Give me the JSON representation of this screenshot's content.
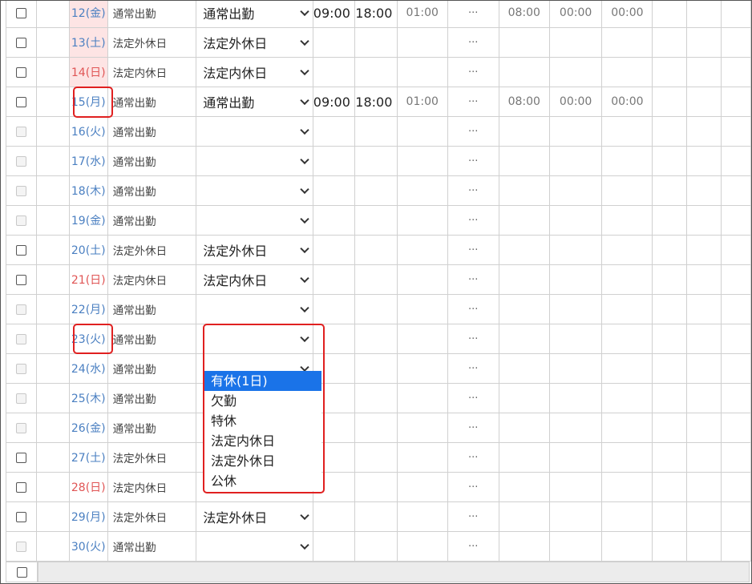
{
  "rows": [
    {
      "date": "12(金)",
      "color": "blue",
      "pink": true,
      "type": "通常出勤",
      "select": "通常出勤",
      "in": "09:00",
      "out": "18:00",
      "brk": "01:00",
      "dots": "···",
      "w1": "08:00",
      "w2": "00:00",
      "w3": "00:00",
      "disabled": false
    },
    {
      "date": "13(土)",
      "color": "blue",
      "pink": true,
      "type": "法定外休日",
      "select": "法定外休日",
      "in": "",
      "out": "",
      "brk": "",
      "dots": "···",
      "w1": "",
      "w2": "",
      "w3": "",
      "disabled": false
    },
    {
      "date": "14(日)",
      "color": "red",
      "pink": true,
      "type": "法定内休日",
      "select": "法定内休日",
      "in": "",
      "out": "",
      "brk": "",
      "dots": "···",
      "w1": "",
      "w2": "",
      "w3": "",
      "disabled": false
    },
    {
      "date": "15(月)",
      "color": "blue",
      "pink": false,
      "type": "通常出勤",
      "select": "通常出勤",
      "in": "09:00",
      "out": "18:00",
      "brk": "01:00",
      "dots": "···",
      "w1": "08:00",
      "w2": "00:00",
      "w3": "00:00",
      "disabled": false
    },
    {
      "date": "16(火)",
      "color": "blue",
      "pink": false,
      "type": "通常出勤",
      "select": "",
      "in": "",
      "out": "",
      "brk": "",
      "dots": "···",
      "w1": "",
      "w2": "",
      "w3": "",
      "disabled": true
    },
    {
      "date": "17(水)",
      "color": "blue",
      "pink": false,
      "type": "通常出勤",
      "select": "",
      "in": "",
      "out": "",
      "brk": "",
      "dots": "···",
      "w1": "",
      "w2": "",
      "w3": "",
      "disabled": true
    },
    {
      "date": "18(木)",
      "color": "blue",
      "pink": false,
      "type": "通常出勤",
      "select": "",
      "in": "",
      "out": "",
      "brk": "",
      "dots": "···",
      "w1": "",
      "w2": "",
      "w3": "",
      "disabled": true
    },
    {
      "date": "19(金)",
      "color": "blue",
      "pink": false,
      "type": "通常出勤",
      "select": "",
      "in": "",
      "out": "",
      "brk": "",
      "dots": "···",
      "w1": "",
      "w2": "",
      "w3": "",
      "disabled": true
    },
    {
      "date": "20(土)",
      "color": "blue",
      "pink": false,
      "type": "法定外休日",
      "select": "法定外休日",
      "in": "",
      "out": "",
      "brk": "",
      "dots": "···",
      "w1": "",
      "w2": "",
      "w3": "",
      "disabled": false
    },
    {
      "date": "21(日)",
      "color": "red",
      "pink": false,
      "type": "法定内休日",
      "select": "法定内休日",
      "in": "",
      "out": "",
      "brk": "",
      "dots": "···",
      "w1": "",
      "w2": "",
      "w3": "",
      "disabled": false
    },
    {
      "date": "22(月)",
      "color": "blue",
      "pink": false,
      "type": "通常出勤",
      "select": "",
      "in": "",
      "out": "",
      "brk": "",
      "dots": "···",
      "w1": "",
      "w2": "",
      "w3": "",
      "disabled": true
    },
    {
      "date": "23(火)",
      "color": "blue",
      "pink": false,
      "type": "通常出勤",
      "select": "",
      "in": "",
      "out": "",
      "brk": "",
      "dots": "···",
      "w1": "",
      "w2": "",
      "w3": "",
      "disabled": true
    },
    {
      "date": "24(水)",
      "color": "blue",
      "pink": false,
      "type": "通常出勤",
      "select": "",
      "in": "",
      "out": "",
      "brk": "",
      "dots": "···",
      "w1": "",
      "w2": "",
      "w3": "",
      "disabled": true
    },
    {
      "date": "25(木)",
      "color": "blue",
      "pink": false,
      "type": "通常出勤",
      "select": "",
      "in": "",
      "out": "",
      "brk": "",
      "dots": "···",
      "w1": "",
      "w2": "",
      "w3": "",
      "disabled": true
    },
    {
      "date": "26(金)",
      "color": "blue",
      "pink": false,
      "type": "通常出勤",
      "select": "",
      "in": "",
      "out": "",
      "brk": "",
      "dots": "···",
      "w1": "",
      "w2": "",
      "w3": "",
      "disabled": true
    },
    {
      "date": "27(土)",
      "color": "blue",
      "pink": false,
      "type": "法定外休日",
      "select": "",
      "in": "",
      "out": "",
      "brk": "",
      "dots": "···",
      "w1": "",
      "w2": "",
      "w3": "",
      "disabled": false
    },
    {
      "date": "28(日)",
      "color": "red",
      "pink": false,
      "type": "法定内休日",
      "select": "",
      "in": "",
      "out": "",
      "brk": "",
      "dots": "···",
      "w1": "",
      "w2": "",
      "w3": "",
      "disabled": false
    },
    {
      "date": "29(月)",
      "color": "blue",
      "pink": false,
      "type": "法定外休日",
      "select": "法定外休日",
      "in": "",
      "out": "",
      "brk": "",
      "dots": "···",
      "w1": "",
      "w2": "",
      "w3": "",
      "disabled": false
    },
    {
      "date": "30(火)",
      "color": "blue",
      "pink": false,
      "type": "通常出勤",
      "select": "",
      "in": "",
      "out": "",
      "brk": "",
      "dots": "···",
      "w1": "",
      "w2": "",
      "w3": "",
      "disabled": true
    }
  ],
  "dropdown": {
    "options": [
      "有休(1日)",
      "欠勤",
      "特休",
      "法定内休日",
      "法定外休日",
      "公休"
    ],
    "selected": "有休(1日)"
  },
  "colors": {
    "date_blue": "#4a7fc1",
    "date_red": "#e05555",
    "highlight": "#e02020",
    "option_selected": "#1a73e8"
  }
}
